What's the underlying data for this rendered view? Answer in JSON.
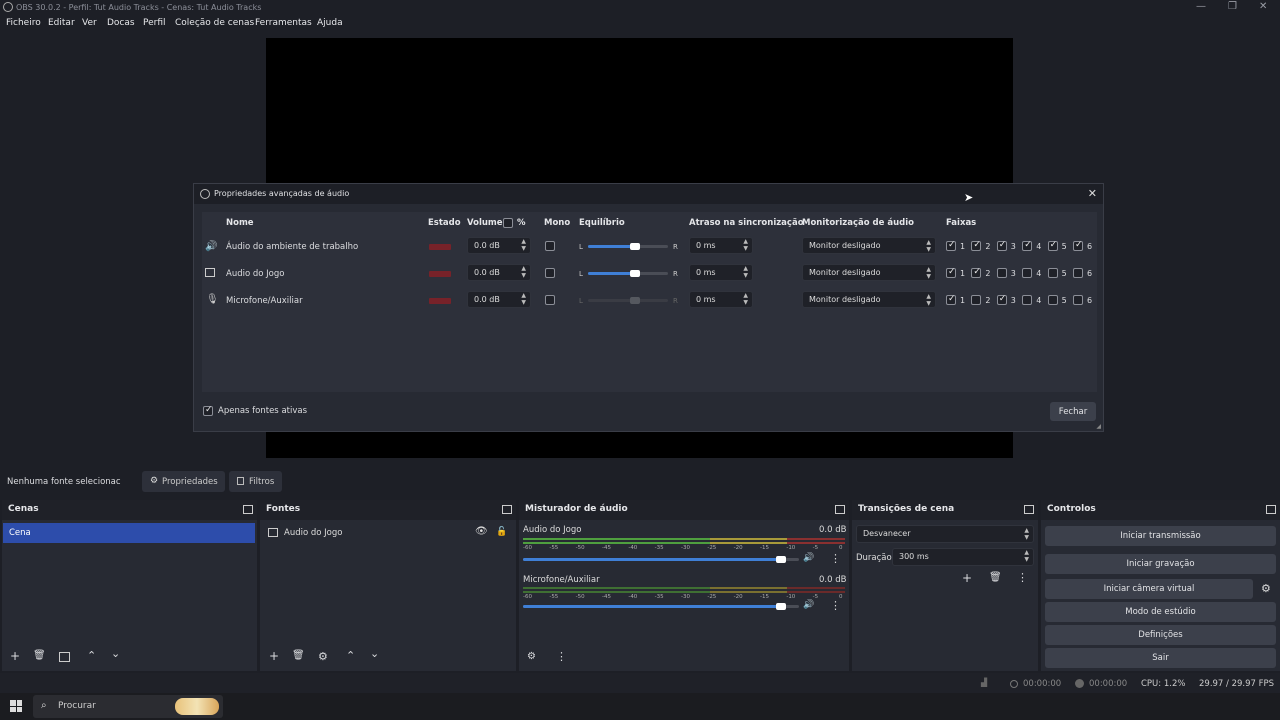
{
  "window": {
    "title": "OBS 30.0.2 - Perfil: Tut Audio Tracks - Cenas: Tut Audio Tracks",
    "minimize_icon": "—",
    "restore_icon": "❐",
    "close_icon": "✕"
  },
  "menu": [
    "Ficheiro",
    "Editar",
    "Ver",
    "Docas",
    "Perfil",
    "Coleção de cenas",
    "Ferramentas",
    "Ajuda"
  ],
  "dialog": {
    "title": "Propriedades avançadas de áudio",
    "close_icon": "✕",
    "headers": {
      "name": "Nome",
      "status": "Estado",
      "volume": "Volume",
      "percent": "%",
      "mono": "Mono",
      "balance": "Equilíbrio",
      "sync_offset": "Atraso na sincronização",
      "monitoring": "Monitorização de áudio",
      "tracks": "Faixas"
    },
    "rows": [
      {
        "name": "Áudio do ambiente de trabalho",
        "icon": "speaker-icon",
        "volume": "0.0 dB",
        "mono": false,
        "balance": 0.5,
        "balance_enabled": true,
        "sync": "0 ms",
        "monitoring": "Monitor desligado",
        "tracks": [
          true,
          true,
          true,
          true,
          true,
          true
        ]
      },
      {
        "name": "Audio do Jogo",
        "icon": "window-capture-icon",
        "volume": "0.0 dB",
        "mono": false,
        "balance": 0.5,
        "balance_enabled": true,
        "sync": "0 ms",
        "monitoring": "Monitor desligado",
        "tracks": [
          true,
          true,
          false,
          false,
          false,
          false
        ]
      },
      {
        "name": "Microfone/Auxiliar",
        "icon": "microphone-icon",
        "volume": "0.0 dB",
        "mono": false,
        "balance": 0.5,
        "balance_enabled": false,
        "sync": "0 ms",
        "monitoring": "Monitor desligado",
        "tracks": [
          true,
          false,
          true,
          false,
          false,
          false
        ]
      }
    ],
    "balance_left": "L",
    "balance_right": "R",
    "track_labels": [
      "1",
      "2",
      "3",
      "4",
      "5",
      "6"
    ],
    "active_only_label": "Apenas fontes ativas",
    "active_only_checked": true,
    "close_button": "Fechar"
  },
  "source_bar": {
    "no_source": "Nenhuma fonte selecionac",
    "properties": "Propriedades",
    "filters": "Filtros"
  },
  "scenes": {
    "title": "Cenas",
    "items": [
      "Cena"
    ]
  },
  "sources": {
    "title": "Fontes",
    "items": [
      "Audio do Jogo"
    ]
  },
  "mixer": {
    "title": "Misturador de áudio",
    "channels": [
      {
        "name": "Audio do Jogo",
        "db": "0.0 dB",
        "level": 0.93
      },
      {
        "name": "Microfone/Auxiliar",
        "db": "0.0 dB",
        "level": 0.93
      }
    ],
    "scale": [
      "-60",
      "-55",
      "-50",
      "-45",
      "-40",
      "-35",
      "-30",
      "-25",
      "-20",
      "-15",
      "-10",
      "-5",
      "0"
    ]
  },
  "transitions": {
    "title": "Transições de cena",
    "selected": "Desvanecer",
    "duration_label": "Duração",
    "duration_value": "300 ms"
  },
  "controls": {
    "title": "Controlos",
    "start_streaming": "Iniciar transmissão",
    "start_recording": "Iniciar gravação",
    "start_virtual_cam": "Iniciar câmera virtual",
    "studio_mode": "Modo de estúdio",
    "settings": "Definições",
    "exit": "Sair"
  },
  "status": {
    "stream_time": "00:00:00",
    "rec_time": "00:00:00",
    "cpu": "CPU: 1.2%",
    "fps": "29.97 / 29.97 FPS"
  },
  "taskbar": {
    "search": "Procurar"
  },
  "colors": {
    "accent": "#3f7fd6",
    "selected_scene": "#2d4dab",
    "background": "#1d1f26",
    "panel": "#272a33"
  }
}
